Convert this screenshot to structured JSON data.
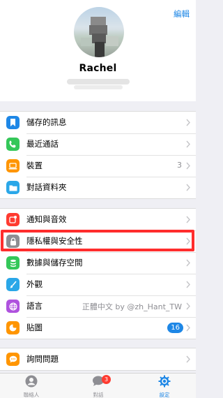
{
  "header": {
    "edit_label": "編輯"
  },
  "profile": {
    "name": "Rachel"
  },
  "groups": [
    {
      "items": [
        {
          "label": "儲存的訊息",
          "icon": "bookmark-icon",
          "color": "#1e87e6"
        },
        {
          "label": "最近通話",
          "icon": "phone-icon",
          "color": "#34c759"
        },
        {
          "label": "裝置",
          "icon": "laptop-icon",
          "color": "#ff9500",
          "value": "3"
        },
        {
          "label": "對話資料夾",
          "icon": "folder-icon",
          "color": "#2aa7e8"
        }
      ]
    },
    {
      "items": [
        {
          "label": "通知與音效",
          "icon": "notification-icon",
          "color": "#ff3b30"
        },
        {
          "label": "隱私權與安全性",
          "icon": "lock-icon",
          "color": "#8e8e93"
        },
        {
          "label": "數據與儲存空間",
          "icon": "database-icon",
          "color": "#34c759"
        },
        {
          "label": "外觀",
          "icon": "brush-icon",
          "color": "#2aa7e8"
        },
        {
          "label": "語言",
          "icon": "globe-icon",
          "color": "#af52de",
          "value": "正體中文 by @zh_Hant_TW"
        },
        {
          "label": "貼圖",
          "icon": "sticker-icon",
          "color": "#ff9500",
          "badge": "16"
        }
      ]
    },
    {
      "items": [
        {
          "label": "詢問問題",
          "icon": "chat-icon",
          "color": "#ff9500"
        }
      ]
    }
  ],
  "tabbar": {
    "tabs": [
      {
        "label": "聯絡人",
        "icon": "contacts-icon"
      },
      {
        "label": "對話",
        "icon": "chats-icon",
        "badge": "3"
      },
      {
        "label": "設定",
        "icon": "settings-icon",
        "active": true
      }
    ]
  },
  "colors": {
    "accent": "#1e87e6",
    "highlight": "#ff2d2d",
    "background": "#efeff4"
  }
}
